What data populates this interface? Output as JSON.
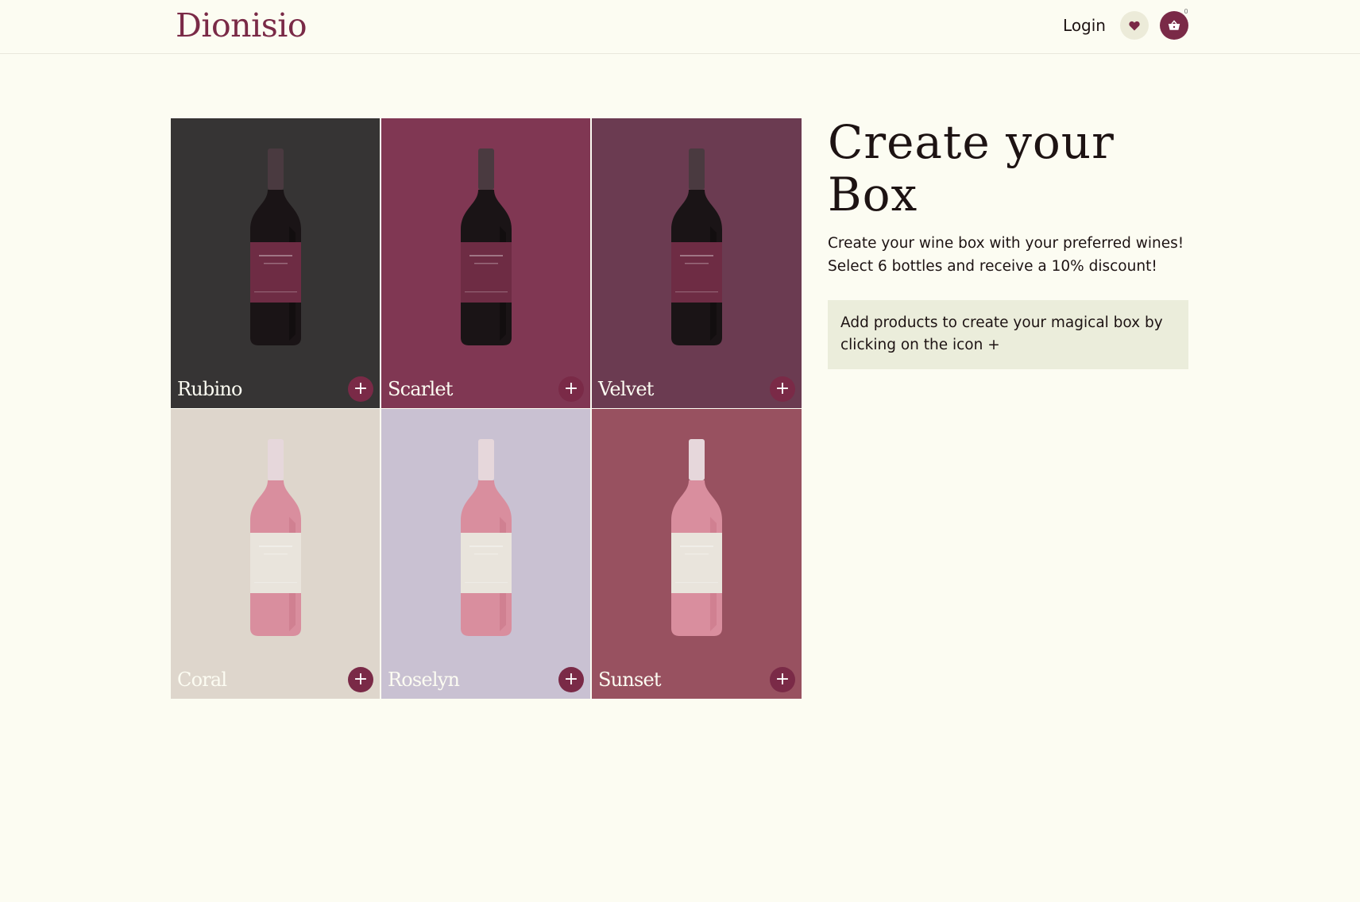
{
  "header": {
    "logo": "Dionisio",
    "login_label": "Login",
    "cart_count": "0",
    "icons": {
      "favorites": "heart-icon",
      "cart": "basket-icon"
    }
  },
  "colors": {
    "brand": "#7a2a47",
    "background": "#fcfcf2",
    "hint_bg": "#ebeddb"
  },
  "products": [
    {
      "name": "Rubino",
      "bg": "#363434",
      "wine": "red",
      "add": "+"
    },
    {
      "name": "Scarlet",
      "bg": "#803753",
      "wine": "red",
      "add": "+"
    },
    {
      "name": "Velvet",
      "bg": "#6b3b51",
      "wine": "red",
      "add": "+"
    },
    {
      "name": "Coral",
      "bg": "#ded6cc",
      "wine": "rose",
      "add": "+"
    },
    {
      "name": "Roselyn",
      "bg": "#c9c1d2",
      "wine": "rose",
      "add": "+"
    },
    {
      "name": "Sunset",
      "bg": "#985160",
      "wine": "rose",
      "add": "+"
    }
  ],
  "box": {
    "title": "Create your Box",
    "description_line1": "Create your wine box with your preferred wines!",
    "description_line2": "Select 6 bottles and receive a 10% discount!",
    "hint": "Add products to create your magical box by clicking on the icon +"
  }
}
